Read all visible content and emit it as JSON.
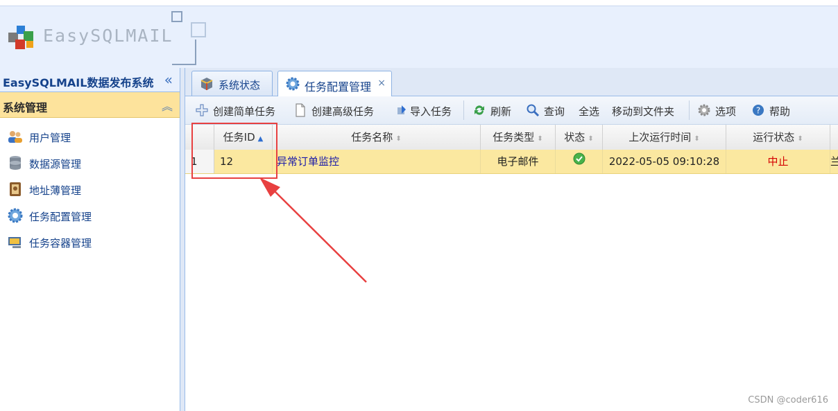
{
  "header": {
    "logo_text": "EasySQLMAIL"
  },
  "left_panel": {
    "title": "EasySQLMAIL数据发布系统",
    "collapse_icon": "double-chevron-left-icon",
    "group": {
      "title": "系统管理",
      "icon": "double-chevron-up-icon"
    },
    "items": [
      {
        "label": "用户管理",
        "icon": "users-icon"
      },
      {
        "label": "数据源管理",
        "icon": "database-icon"
      },
      {
        "label": "地址薄管理",
        "icon": "address-book-icon"
      },
      {
        "label": "任务配置管理",
        "icon": "gear-icon"
      },
      {
        "label": "任务容器管理",
        "icon": "container-icon"
      }
    ]
  },
  "tabs": [
    {
      "label": "系统状态",
      "icon": "status-icon",
      "active": false
    },
    {
      "label": "任务配置管理",
      "icon": "gear-icon",
      "active": true,
      "close": "×"
    }
  ],
  "toolbar": {
    "items": [
      {
        "label": "创建简单任务",
        "icon": "plus-icon"
      },
      {
        "label": "创建高级任务",
        "icon": "document-icon"
      },
      {
        "label": "导入任务",
        "icon": "import-icon"
      },
      {
        "label": "刷新",
        "icon": "refresh-icon"
      },
      {
        "label": "查询",
        "icon": "search-icon"
      },
      {
        "label": "全选"
      },
      {
        "label": "移动到文件夹"
      },
      {
        "label": "选项",
        "icon": "gear-icon"
      },
      {
        "label": "帮助",
        "icon": "help-icon"
      }
    ]
  },
  "grid": {
    "columns": [
      {
        "label": "任务ID",
        "sorted": "asc"
      },
      {
        "label": "任务名称"
      },
      {
        "label": "任务类型"
      },
      {
        "label": "状态"
      },
      {
        "label": "上次运行时间"
      },
      {
        "label": "运行状态"
      }
    ],
    "rows": [
      {
        "row_number": "1",
        "id": "12",
        "name": "异常订单监控",
        "type": "电子邮件",
        "status_icon": "check-circle-icon",
        "last_run": "2022-05-05 09:10:28",
        "run_status": "中止",
        "overflow": "兰"
      }
    ]
  },
  "colors": {
    "accent_blue": "#15428b",
    "row_highlight": "#fbe8a0",
    "stopped_red": "#d40000",
    "annotation_red": "#e84040"
  },
  "watermark": "CSDN @coder616"
}
